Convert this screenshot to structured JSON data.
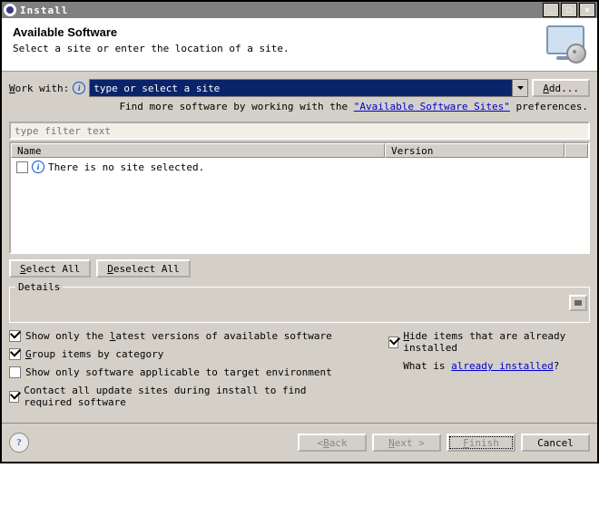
{
  "window": {
    "title": "Install"
  },
  "header": {
    "title": "Available Software",
    "subtitle": "Select a site or enter the location of a site."
  },
  "work_with": {
    "label_pre": "W",
    "label_rest": "ork with:",
    "value": "type or select a site",
    "add_label": "Add...",
    "hint_pre": "Find more software by working with the ",
    "hint_link": "\"Available Software Sites\"",
    "hint_post": " preferences."
  },
  "filter": {
    "placeholder": "type filter text"
  },
  "table": {
    "columns": {
      "name": "Name",
      "version": "Version"
    },
    "rows": [
      {
        "checked": false,
        "text": "There is no site selected."
      }
    ]
  },
  "buttons": {
    "select_all": "Select All",
    "deselect_all": "Deselect All",
    "back": "< Back",
    "next": "Next >",
    "finish": "Finish",
    "cancel": "Cancel"
  },
  "details": {
    "legend": "Details"
  },
  "options": {
    "latest": {
      "checked": true,
      "label": "Show only the latest versions of available software"
    },
    "group": {
      "checked": true,
      "label": "Group items by category"
    },
    "target": {
      "checked": false,
      "label": "Show only software applicable to target environment"
    },
    "contact": {
      "checked": true,
      "label": "Contact all update sites during install to find required software"
    },
    "hide": {
      "checked": true,
      "label": "Hide items that are already installed"
    },
    "whatis_pre": "What is ",
    "whatis_link": "already installed",
    "whatis_post": "?"
  }
}
